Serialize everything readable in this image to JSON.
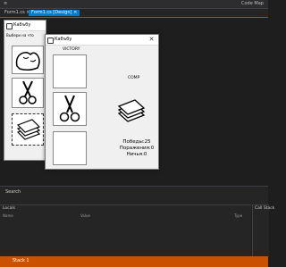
{
  "ide": {
    "menu_items": [
      "Code Map"
    ],
    "tabs": [
      "Form1.cs  ×",
      "Form1.cs [Design]  ×"
    ],
    "search_label": "Search",
    "locals_title": "Locals",
    "locals_columns": [
      "Name",
      "Value",
      "Type"
    ],
    "callstack_title": "Call Stack",
    "status_left": "Stack 1"
  },
  "designer": {
    "title": "Кабъбу",
    "hint": "Выбери на что"
  },
  "game": {
    "title": "Кабъбу",
    "victory_label": "VICTORY",
    "comp_label": "COMP",
    "stats": {
      "wins": "Победы:25",
      "losses": "Поражения:0",
      "draws": "Ничья:0"
    }
  },
  "colors": {
    "ide_bg": "#1e1e1e",
    "accent": "#007acc",
    "statusbar": "#ca5100",
    "window_bg": "#f0f0f0"
  }
}
